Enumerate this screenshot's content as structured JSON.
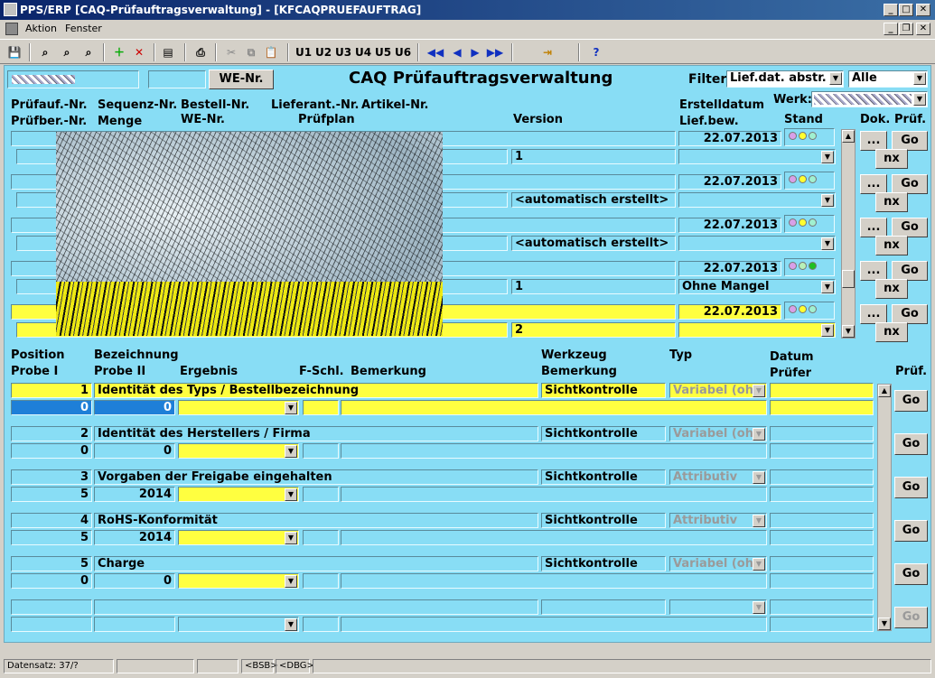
{
  "window": {
    "title": "PPS/ERP [CAQ-Prüfauftragsverwaltung] - [KFCAQPRUEFAUFTRAG]"
  },
  "menu": {
    "aktion": "Aktion",
    "fenster": "Fenster"
  },
  "toolbar": {
    "u1": "U1",
    "u2": "U2",
    "u3": "U3",
    "u4": "U4",
    "u5": "U5",
    "u6": "U6",
    "help": "?"
  },
  "header": {
    "we_button": "WE-Nr.",
    "title": "CAQ Prüfauftragsverwaltung",
    "filter_label": "Filter:",
    "filter_value": "Lief.dat. abstr.",
    "filter2_value": "Alle",
    "werk_label": "Werk:"
  },
  "orders": {
    "col_pruefauf": "Prüfauf.-Nr.",
    "col_pruefber": "Prüfber.-Nr.",
    "col_sequenz": "Sequenz-Nr.",
    "col_menge": "Menge",
    "col_bestell": "Bestell-Nr.",
    "col_we": "WE-Nr.",
    "col_lieferant": "Lieferant.-Nr.",
    "col_pruefplan": "Prüfplan",
    "col_artikel": "Artikel-Nr.",
    "col_version": "Version",
    "col_erstelldatum": "Erstelldatum",
    "col_liefbew": "Lief.bew.",
    "col_stand": "Stand",
    "col_dok": "Dok.",
    "col_pruef": "Prüf.",
    "rows": [
      {
        "date": "22.07.2013",
        "version": "1",
        "liefbew": ""
      },
      {
        "date": "22.07.2013",
        "version": "<automatisch erstellt>",
        "liefbew": ""
      },
      {
        "date": "22.07.2013",
        "version": "<automatisch erstellt>",
        "liefbew": ""
      },
      {
        "date": "22.07.2013",
        "version": "1",
        "liefbew": "Ohne Mangel"
      },
      {
        "date": "22.07.2013",
        "version": "2",
        "liefbew": ""
      }
    ],
    "btn_dots": "...",
    "btn_go": "Go",
    "btn_nx": "nx"
  },
  "positions": {
    "col_position": "Position",
    "col_probe1": "Probe I",
    "col_bezeichnung": "Bezeichnung",
    "col_probe2": "Probe II",
    "col_ergebnis": "Ergebnis",
    "col_fschl": "F-Schl.",
    "col_bemerkung": "Bemerkung",
    "col_werkzeug": "Werkzeug",
    "col_bemerkung2": "Bemerkung",
    "col_typ": "Typ",
    "col_datum": "Datum",
    "col_pruefer": "Prüfer",
    "col_pruef": "Prüf.",
    "rows": [
      {
        "pos": "1",
        "bez": "Identität des Typs / Bestellbezeichnung",
        "probe1": "0",
        "probe2": "0",
        "werkzeug": "Sichtkontrolle",
        "typ": "Variabel (oh"
      },
      {
        "pos": "2",
        "bez": "Identität des Herstellers / Firma",
        "probe1": "0",
        "probe2": "0",
        "werkzeug": "Sichtkontrolle",
        "typ": "Variabel (oh"
      },
      {
        "pos": "3",
        "bez": "Vorgaben der Freigabe eingehalten",
        "probe1": "5",
        "probe2": "2014",
        "werkzeug": "Sichtkontrolle",
        "typ": "Attributiv"
      },
      {
        "pos": "4",
        "bez": "RoHS-Konformität",
        "probe1": "5",
        "probe2": "2014",
        "werkzeug": "Sichtkontrolle",
        "typ": "Attributiv"
      },
      {
        "pos": "5",
        "bez": "Charge",
        "probe1": "0",
        "probe2": "0",
        "werkzeug": "Sichtkontrolle",
        "typ": "Variabel (oh"
      }
    ],
    "btn_go": "Go"
  },
  "status": {
    "datensatz": "Datensatz: 37/?",
    "bsb": "<BSB>",
    "dbg": "<DBG>"
  },
  "colors": {
    "form_bg": "#88ddf5",
    "highlight": "#ffff40",
    "selected": "#1e7fd8",
    "titlebar": "#0a246a"
  }
}
